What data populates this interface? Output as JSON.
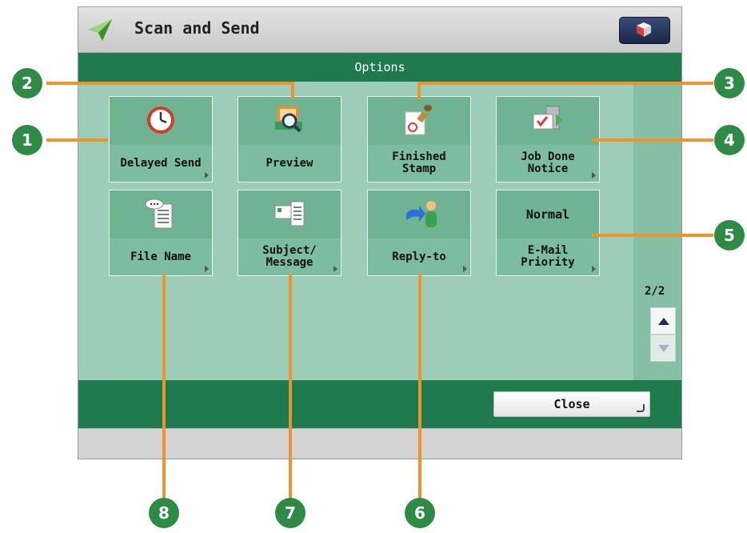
{
  "window": {
    "title": "Scan and Send"
  },
  "header": {
    "title": "Options"
  },
  "tiles": [
    {
      "label": "Delayed Send",
      "icon": "clock-icon",
      "has_arrow": true
    },
    {
      "label": "Preview",
      "icon": "magnifier-preview-icon",
      "has_arrow": false
    },
    {
      "label": "Finished\nStamp",
      "icon": "stamp-icon",
      "has_arrow": false
    },
    {
      "label": "Job Done\nNotice",
      "icon": "mail-notice-icon",
      "has_arrow": true
    },
    {
      "label": "File Name",
      "icon": "document-bubble-icon",
      "has_arrow": true
    },
    {
      "label": "Subject/\nMessage",
      "icon": "message-card-icon",
      "has_arrow": true
    },
    {
      "label": "Reply-to",
      "icon": "reply-person-icon",
      "has_arrow": true
    },
    {
      "label": "E-Mail\nPriority",
      "value": "Normal",
      "has_arrow": true
    }
  ],
  "pager": {
    "text": "2/2"
  },
  "footer": {
    "close_label": "Close"
  },
  "callouts": [
    "1",
    "2",
    "3",
    "4",
    "5",
    "6",
    "7",
    "8"
  ],
  "colors": {
    "accent": "#1f7a4d",
    "callout": "#f0922e",
    "badge": "#2e8b45",
    "content_bg": "#9bcdb8"
  }
}
